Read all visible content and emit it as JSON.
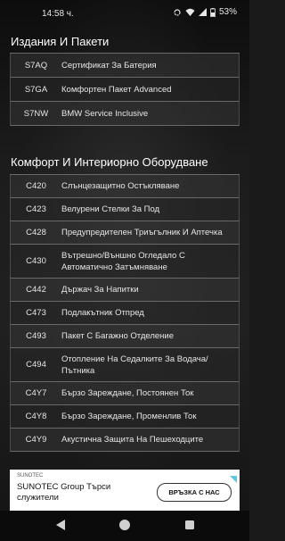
{
  "status": {
    "time": "14:58 ч.",
    "battery": "53%",
    "icons": [
      "sync-icon",
      "wifi-icon",
      "signal-icon",
      "battery-icon"
    ]
  },
  "sections": [
    {
      "title": "Издания И Пакети",
      "rows": [
        {
          "code": "S7AQ",
          "desc": "Сертификат За Батерия"
        },
        {
          "code": "S7GA",
          "desc": "Комфортен Пакет Advanced"
        },
        {
          "code": "S7NW",
          "desc": "BMW Service Inclusive"
        }
      ]
    },
    {
      "title": "Комфорт И Интериорно Оборудване",
      "rows": [
        {
          "code": "C420",
          "desc": "Слънцезащитно Остъкляване"
        },
        {
          "code": "C423",
          "desc": "Велурени Стелки За Под"
        },
        {
          "code": "C428",
          "desc": "Предупредителен Триъгълник И Аптечка"
        },
        {
          "code": "C430",
          "desc": "Вътрешно/Външно Огледало С Автоматично Затъмняване"
        },
        {
          "code": "C442",
          "desc": "Държач За Напитки"
        },
        {
          "code": "C473",
          "desc": "Подлакътник Отпред"
        },
        {
          "code": "C493",
          "desc": "Пакет С Багажно Отделение"
        },
        {
          "code": "C494",
          "desc": "Отопление На Седалките За Водача/Пътника"
        },
        {
          "code": "C4Y7",
          "desc": "Бързо Зареждане, Постоянен Ток"
        },
        {
          "code": "C4Y8",
          "desc": "Бързо Зареждане, Променлив Ток"
        },
        {
          "code": "C4Y9",
          "desc": "Акустична Защита На Пешеходците"
        }
      ]
    }
  ],
  "ad": {
    "brand": "SUNOTEC",
    "text": "SUNOTEC Group Търси служители",
    "button": "ВРЪЗКА С НАС"
  },
  "nav": {
    "icons": [
      "back-icon",
      "home-icon",
      "recents-icon"
    ]
  }
}
